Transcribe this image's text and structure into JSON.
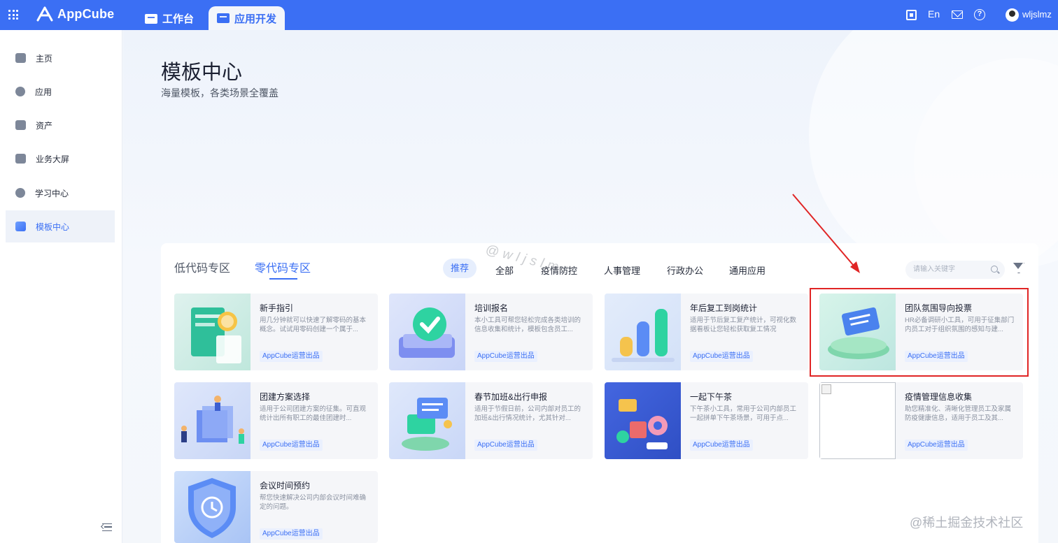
{
  "app": {
    "name": "AppCube",
    "accent": "#3b6ff4"
  },
  "topnav": {
    "tabs": [
      {
        "label": "工作台"
      },
      {
        "label": "应用开发"
      }
    ],
    "lang": "En",
    "user": "wljslmz"
  },
  "sidebar": {
    "items": [
      {
        "label": "主页",
        "icon": "home-icon"
      },
      {
        "label": "应用",
        "icon": "app-icon"
      },
      {
        "label": "资产",
        "icon": "database-icon"
      },
      {
        "label": "业务大屏",
        "icon": "chart-icon"
      },
      {
        "label": "学习中心",
        "icon": "learn-icon"
      },
      {
        "label": "模板中心",
        "icon": "layers-icon",
        "active": true
      }
    ]
  },
  "header": {
    "title": "模板中心",
    "subtitle": "海量模板，各类场景全覆盖"
  },
  "zones": {
    "tabs": [
      {
        "label": "低代码专区"
      },
      {
        "label": "零代码专区",
        "active": true
      }
    ]
  },
  "categories": [
    {
      "label": "推荐",
      "active": true
    },
    {
      "label": "全部"
    },
    {
      "label": "疫情防控"
    },
    {
      "label": "人事管理"
    },
    {
      "label": "行政办公"
    },
    {
      "label": "通用应用"
    }
  ],
  "search": {
    "placeholder": "请输入关键字"
  },
  "cards": [
    {
      "title": "新手指引",
      "desc": "用几分钟就可以快速了解零码的基本概念。试试用零码创建一个属于...",
      "badge": "AppCube运营出品"
    },
    {
      "title": "培训报名",
      "desc": "本小工具可帮您轻松完成各类培训的信息收集和统计，模板包含员工...",
      "badge": "AppCube运营出品"
    },
    {
      "title": "年后复工到岗统计",
      "desc": "适用于节后复工复产统计，可视化数据看板让您轻松获取复工情况",
      "badge": "AppCube运营出品"
    },
    {
      "title": "团队氛围导向投票",
      "desc": "HR必备调研小工具，可用于征集部门内员工对于组织氛围的感知与建...",
      "badge": "AppCube运营出品"
    },
    {
      "title": "团建方案选择",
      "desc": "适用于公司团建方案的征集。可直观统计出所有职工的最佳团建时...",
      "badge": "AppCube运营出品"
    },
    {
      "title": "春节加班&出行申报",
      "desc": "适用于节假日前，公司内部对员工的加班&出行情况统计，尤其针对...",
      "badge": "AppCube运营出品"
    },
    {
      "title": "一起下午茶",
      "desc": "下午茶小工具，常用于公司内部员工一起拼单下午茶场景，可用于点...",
      "badge": "AppCube运营出品"
    },
    {
      "title": "疫情管理信息收集",
      "desc": "助您精准化、清晰化管理员工及家属防疫健康信息，适用于员工及其...",
      "badge": "AppCube运营出品"
    },
    {
      "title": "会议时间预约",
      "desc": "帮您快速解决公司内部会议时间难确定的问题。",
      "badge": "AppCube运营出品"
    }
  ],
  "watermark": "@wljslmz",
  "site_watermark": "@稀土掘金技术社区"
}
